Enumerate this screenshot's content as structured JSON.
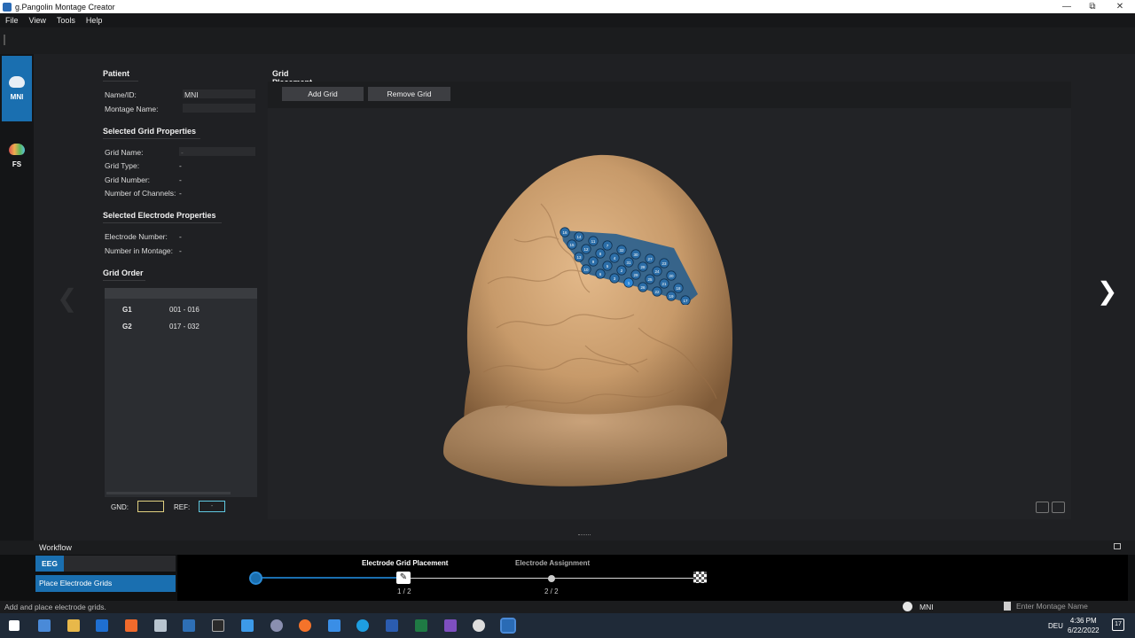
{
  "window": {
    "title": "g.Pangolin Montage Creator"
  },
  "menu": [
    "File",
    "View",
    "Tools",
    "Help"
  ],
  "rail": [
    {
      "label": "MNI",
      "icon": "brain-icon",
      "active": true
    },
    {
      "label": "FS",
      "icon": "colored-brain-icon",
      "active": false
    }
  ],
  "patient": {
    "title": "Patient",
    "name_label": "Name/ID:",
    "name_value": "MNI",
    "montage_label": "Montage Name:",
    "montage_value": ""
  },
  "grid_props": {
    "title": "Selected Grid Properties",
    "rows": [
      {
        "label": "Grid Name:",
        "value": "-"
      },
      {
        "label": "Grid Type:",
        "value": "-"
      },
      {
        "label": "Grid Number:",
        "value": "-"
      },
      {
        "label": "Number of Channels:",
        "value": "-"
      }
    ]
  },
  "electrode_props": {
    "title": "Selected Electrode Properties",
    "rows": [
      {
        "label": "Electrode Number:",
        "value": "-"
      },
      {
        "label": "Number in Montage:",
        "value": "-"
      }
    ]
  },
  "grid_order": {
    "title": "Grid Order",
    "items": [
      {
        "name": "G1",
        "range": "001 - 016"
      },
      {
        "name": "G2",
        "range": "017 - 032"
      }
    ],
    "gnd_label": "GND:",
    "ref_label": "REF:",
    "ref_value": "-"
  },
  "grid_placement": {
    "title": "Grid Placement",
    "add_label": "Add Grid",
    "remove_label": "Remove Grid",
    "electrode_numbers": [
      "16",
      "14",
      "11",
      "7",
      "32",
      "30",
      "27",
      "23",
      "15",
      "12",
      "8",
      "4",
      "31",
      "28",
      "24",
      "20",
      "13",
      "9",
      "5",
      "2",
      "29",
      "25",
      "21",
      "18",
      "10",
      "6",
      "3",
      "1",
      "26",
      "22",
      "19",
      "17"
    ]
  },
  "workflow": {
    "title": "Workflow",
    "tab": "EEG",
    "step_button": "Place Electrode Grids",
    "steps": [
      {
        "title": "Electrode Grid Placement",
        "frac": "1 / 2",
        "active": true
      },
      {
        "title": "Electrode Assignment",
        "frac": "2 / 2",
        "active": false
      }
    ]
  },
  "status": {
    "message": "Add and place electrode grids.",
    "user": "MNI",
    "montage_placeholder": "Enter Montage Name"
  },
  "taskbar": {
    "time": "4:36 PM",
    "date": "6/22/2022",
    "lang": "DEU",
    "notifications": "17"
  },
  "colors": {
    "accent": "#1a6fb0",
    "brain": "#c79a6a",
    "grid": "#1d5a8f",
    "gnd_border": "#e0d080",
    "ref_border": "#5fc8e0"
  }
}
